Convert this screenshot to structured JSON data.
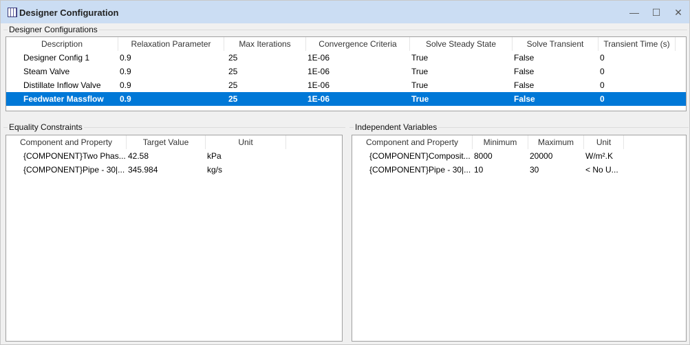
{
  "window": {
    "title": "Designer Configuration",
    "minimize": "—",
    "maximize": "☐",
    "close": "✕",
    "icon": "calculator-grid-icon"
  },
  "designer": {
    "label": "Designer Configurations",
    "columns": [
      "Description",
      "Relaxation Parameter",
      "Max Iterations",
      "Convergence Criteria",
      "Solve Steady State",
      "Solve Transient",
      "Transient Time (s)"
    ],
    "rows": [
      [
        "Designer Config 1",
        "0.9",
        "25",
        "1E-06",
        "True",
        "False",
        "0"
      ],
      [
        "Steam Valve",
        "0.9",
        "25",
        "1E-06",
        "True",
        "False",
        "0"
      ],
      [
        "Distillate Inflow Valve",
        "0.9",
        "25",
        "1E-06",
        "True",
        "False",
        "0"
      ],
      [
        "Feedwater Massflow",
        "0.9",
        "25",
        "1E-06",
        "True",
        "False",
        "0"
      ]
    ],
    "selected_row": 3
  },
  "equality": {
    "label": "Equality Constraints",
    "columns": [
      "Component and Property",
      "Target Value",
      "Unit"
    ],
    "rows": [
      [
        "{COMPONENT}Two Phas...",
        "42.58",
        "kPa"
      ],
      [
        "{COMPONENT}Pipe - 30|...",
        "345.984",
        "kg/s"
      ]
    ]
  },
  "independent": {
    "label": "Independent Variables",
    "columns": [
      "Component and Property",
      "Minimum",
      "Maximum",
      "Unit"
    ],
    "rows": [
      [
        "{COMPONENT}Composit...",
        "8000",
        "20000",
        "W/m².K"
      ],
      [
        "{COMPONENT}Pipe - 30|...",
        "10",
        "30",
        "< No U..."
      ]
    ]
  },
  "colors": {
    "selection": "#0078d7",
    "titlebar": "#cbddf3"
  }
}
